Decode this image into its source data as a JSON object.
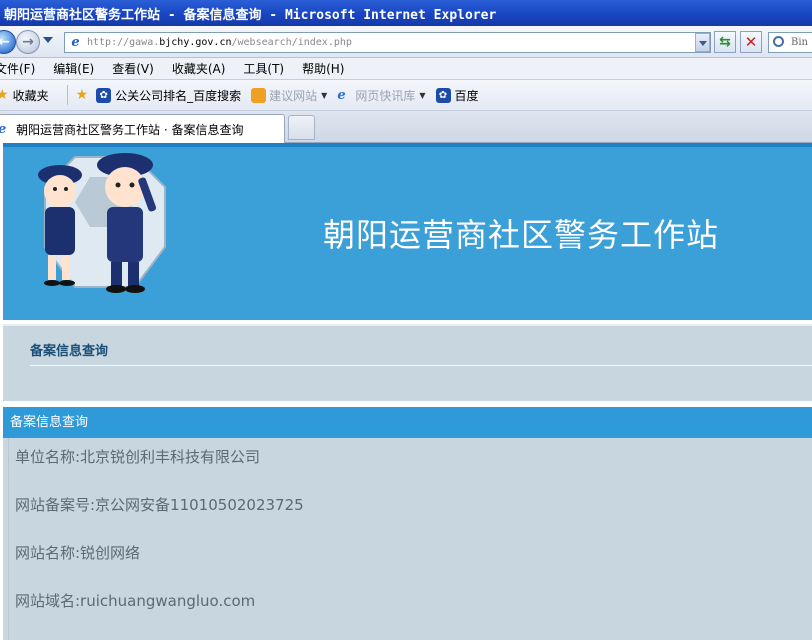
{
  "window": {
    "title": "朝阳运营商社区警务工作站 - 备案信息查询 - Microsoft Internet Explorer"
  },
  "address": {
    "url_prefix": "http://gawa.",
    "url_domain": "bjchy.gov.cn",
    "url_path": "/websearch/index.php",
    "search_placeholder": "Bin"
  },
  "menu": {
    "items": [
      "文件(F)",
      "编辑(E)",
      "查看(V)",
      "收藏夹(A)",
      "工具(T)",
      "帮助(H)"
    ]
  },
  "favorites": {
    "label": "收藏夹",
    "items": [
      {
        "label": "公关公司排名_百度搜索",
        "icon": "baidu-paw-icon"
      },
      {
        "label": "建议网站",
        "icon": "suggested-sites-icon",
        "dropdown": true
      },
      {
        "label": "网页快讯库",
        "icon": "web-slice-icon",
        "dropdown": true
      },
      {
        "label": "百度",
        "icon": "baidu-paw-icon"
      }
    ]
  },
  "tab": {
    "title": "朝阳运营商社区警务工作站 · 备案信息查询"
  },
  "banner": {
    "title": "朝阳运营商社区警务工作站"
  },
  "breadcrumb": {
    "title": "备案信息查询"
  },
  "panel": {
    "header": "备案信息查询",
    "rows": [
      "单位名称:北京锐创利丰科技有限公司",
      "网站备案号:京公网安备11010502023725",
      "网站名称:锐创网络",
      "网站域名:ruichuangwangluo.com"
    ]
  },
  "colors": {
    "banner": "#3b9fd8",
    "panel_bg": "#c7d6df",
    "panel_header": "#2e9ad8"
  }
}
